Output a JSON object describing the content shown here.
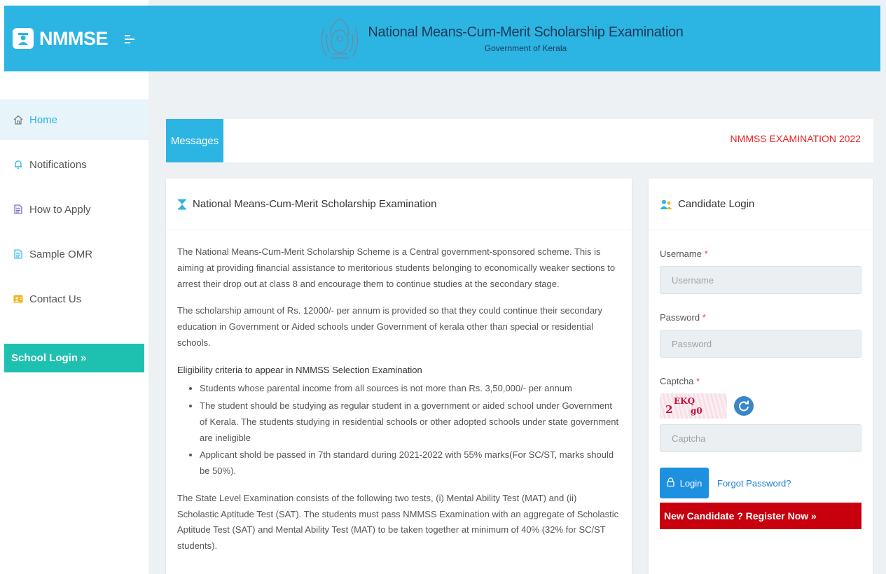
{
  "brand": {
    "name": "NMMSE",
    "logo_icon": "graduate-icon"
  },
  "header": {
    "title": "National Means-Cum-Merit Scholarship Examination",
    "subtitle": "Government of Kerala"
  },
  "sidebar": {
    "items": [
      {
        "label": "Home",
        "icon": "home-icon",
        "active": true
      },
      {
        "label": "Notifications",
        "icon": "bell-icon"
      },
      {
        "label": "How to Apply",
        "icon": "document-icon"
      },
      {
        "label": "Sample OMR",
        "icon": "document-icon"
      },
      {
        "label": "Contact Us",
        "icon": "contact-card-icon"
      }
    ],
    "school_login": "School Login »"
  },
  "messages": {
    "tab_label": "Messages",
    "marquee": "NMMSS EXAMINATION 2022"
  },
  "main": {
    "title": "National Means-Cum-Merit Scholarship Examination",
    "para1": "The National Means-Cum-Merit Scholarship Scheme is a Central government-sponsored scheme. This is aiming at providing financial assistance to meritorious students belonging to economically weaker sections to arrest their drop out at class 8 and encourage them to continue studies at the secondary stage.",
    "para2": "The scholarship amount of Rs. 12000/- per annum is provided so that they could continue their secondary education in Government or Aided schools under Government of kerala other than special or residential schools.",
    "eligibility_title": "Eligibility criteria to appear in NMMSS Selection Examination",
    "eligibility": [
      "Students whose parental income from all sources is not more than Rs. 3,50,000/- per annum",
      "The student should be studying as regular student in a government or aided school under Government of Kerala. The students studying in residential schools or other adopted schools under state government are ineligible",
      "Applicant shold be passed in 7th standard during 2021-2022 with 55% marks(For SC/ST, marks should be 50%)."
    ],
    "para3": "The State Level Examination consists of the following two tests, (i) Mental Ability Test (MAT) and (ii) Scholastic Aptitude Test (SAT). The students must pass NMMSS Examination with an aggregate of Scholastic Aptitude Test (SAT) and Mental Ability Test (MAT) to be taken together at minimum of 40% (32% for SC/ST students)."
  },
  "login": {
    "title": "Candidate Login",
    "username_label": "Username",
    "username_placeholder": "Username",
    "password_label": "Password",
    "password_placeholder": "Password",
    "captcha_label": "Captcha",
    "captcha_placeholder": "Captcha",
    "required_mark": "*",
    "captcha_text": {
      "a": "2",
      "b": "EKQ",
      "c": "g0"
    },
    "login_button": "Login",
    "forgot_password": "Forgot Password?",
    "register": "New Candidate ? Register Now »"
  },
  "colors": {
    "primary": "#2cb4e3",
    "teal": "#1ec0b0",
    "danger": "#c8000e",
    "link": "#1e7fd0",
    "marquee": "#ee2222"
  }
}
